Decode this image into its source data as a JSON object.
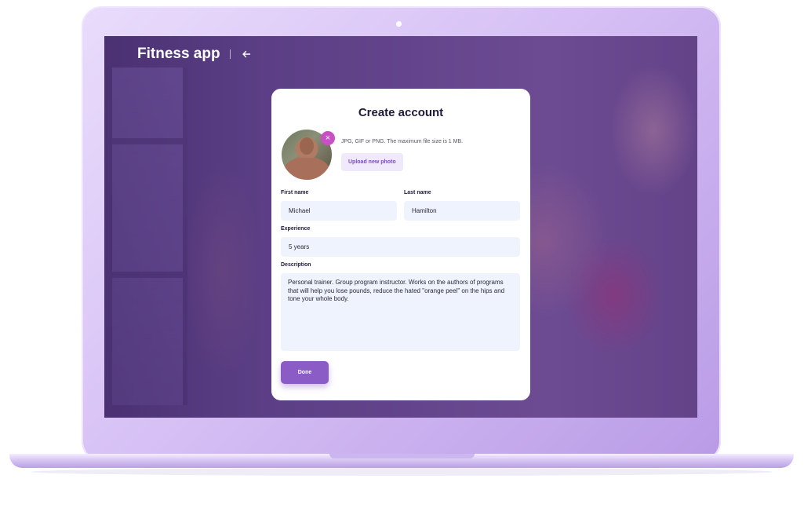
{
  "app": {
    "title": "Fitness app"
  },
  "form": {
    "title": "Create account",
    "photo": {
      "hint": "JPG, GIF or PNG. The maximum file size is 1 MB.",
      "upload_label": "Upload new photo",
      "remove_symbol": "×"
    },
    "first_name": {
      "label": "First name",
      "value": "Michael"
    },
    "last_name": {
      "label": "Last name",
      "value": "Hamilton"
    },
    "experience": {
      "label": "Experience",
      "value": "5 years"
    },
    "description": {
      "label": "Description",
      "value": "Personal trainer. Group program instructor. Works on the authors of programs that will help you lose pounds, reduce the hated \"orange peel\" on the hips and tone your whole body."
    },
    "submit_label": "Done"
  },
  "icons": {
    "back": "arrow-left-icon",
    "remove": "close-icon"
  },
  "colors": {
    "accent": "#8b5cc6",
    "remove_badge": "#c94fc5",
    "field_bg": "#eef3fd",
    "overlay": "#5c3a96"
  }
}
